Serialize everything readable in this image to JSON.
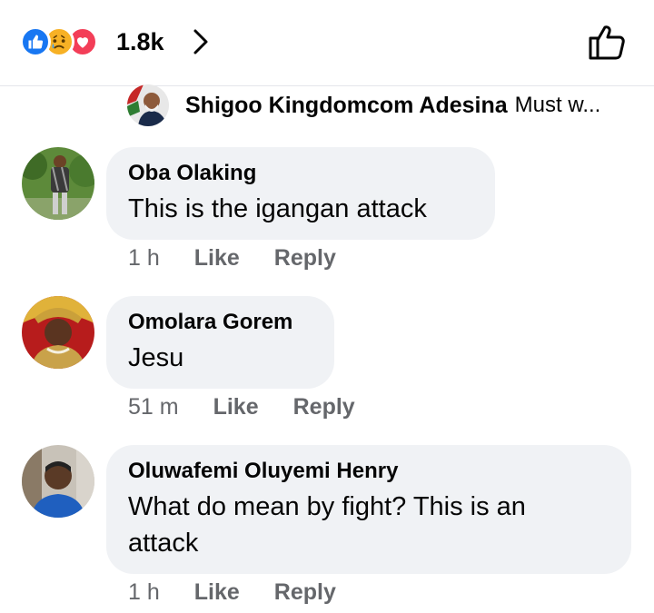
{
  "header": {
    "reactions": [
      {
        "type": "like",
        "icon": "like-reaction-icon",
        "color": "#1877f2"
      },
      {
        "type": "sad",
        "icon": "sad-reaction-icon",
        "color": "#f7b125"
      },
      {
        "type": "love",
        "icon": "love-reaction-icon",
        "color": "#f33e58"
      }
    ],
    "reaction_count": "1.8k",
    "chevron_icon": "chevron-right-icon",
    "like_icon": "thumbs-up-outline-icon"
  },
  "replied_to": {
    "name": "Shigoo Kingdomcom Adesina",
    "snippet": "Must w..."
  },
  "comments": [
    {
      "name": "Oba Olaking",
      "text": "This is the igangan attack",
      "time": "1 h",
      "like": "Like",
      "reply": "Reply"
    },
    {
      "name": "Omolara Gorem",
      "text": "Jesu",
      "time": "51 m",
      "like": "Like",
      "reply": "Reply"
    },
    {
      "name": "Oluwafemi Oluyemi Henry",
      "text": "What do mean by fight? This is an attack",
      "time": "1 h",
      "like": "Like",
      "reply": "Reply"
    }
  ],
  "colors": {
    "bubble": "#f0f2f5",
    "meta": "#65676b",
    "text": "#050505",
    "accent": "#1877f2"
  }
}
